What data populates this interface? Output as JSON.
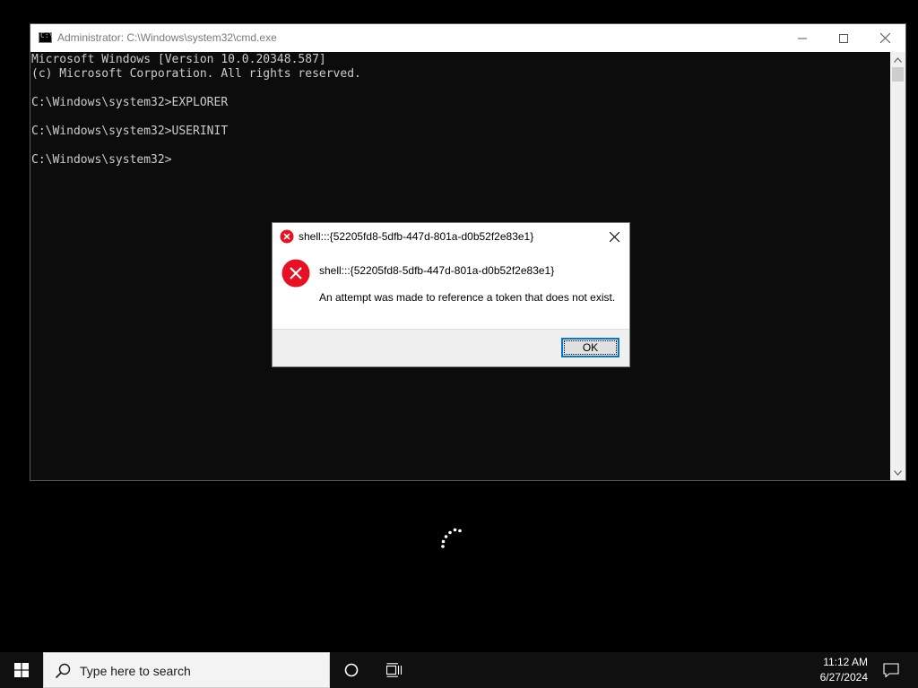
{
  "cmd_window": {
    "title": "Administrator: C:\\Windows\\system32\\cmd.exe",
    "icon": "cmd-icon",
    "icon_glyph": "C:\\",
    "controls": {
      "minimize_icon": "minimize-icon",
      "maximize_icon": "maximize-icon",
      "close_icon": "close-icon"
    },
    "lines": [
      "Microsoft Windows [Version 10.0.20348.587]",
      "(c) Microsoft Corporation. All rights reserved.",
      "",
      "C:\\Windows\\system32>EXPLORER",
      "",
      "C:\\Windows\\system32>USERINIT",
      "",
      "C:\\Windows\\system32>"
    ],
    "background_color": "#0c0c0c",
    "text_color": "#cccccc"
  },
  "dialog": {
    "title": "shell:::{52205fd8-5dfb-447d-801a-d0b52f2e83e1}",
    "heading": "shell:::{52205fd8-5dfb-447d-801a-d0b52f2e83e1}",
    "message": "An attempt was made to reference a token that does not exist.",
    "ok_label": "OK",
    "icon": "error-icon",
    "error_color": "#e81123"
  },
  "taskbar": {
    "start_icon": "windows-logo-icon",
    "search_placeholder": "Type here to search",
    "search_icon": "search-icon",
    "cortana_icon": "cortana-icon",
    "taskview_icon": "task-view-icon",
    "clock_time": "11:12 AM",
    "clock_date": "6/27/2024",
    "notification_icon": "notification-icon",
    "accent_color": "#0078d7"
  },
  "spinner": {
    "icon": "loading-spinner-icon"
  }
}
